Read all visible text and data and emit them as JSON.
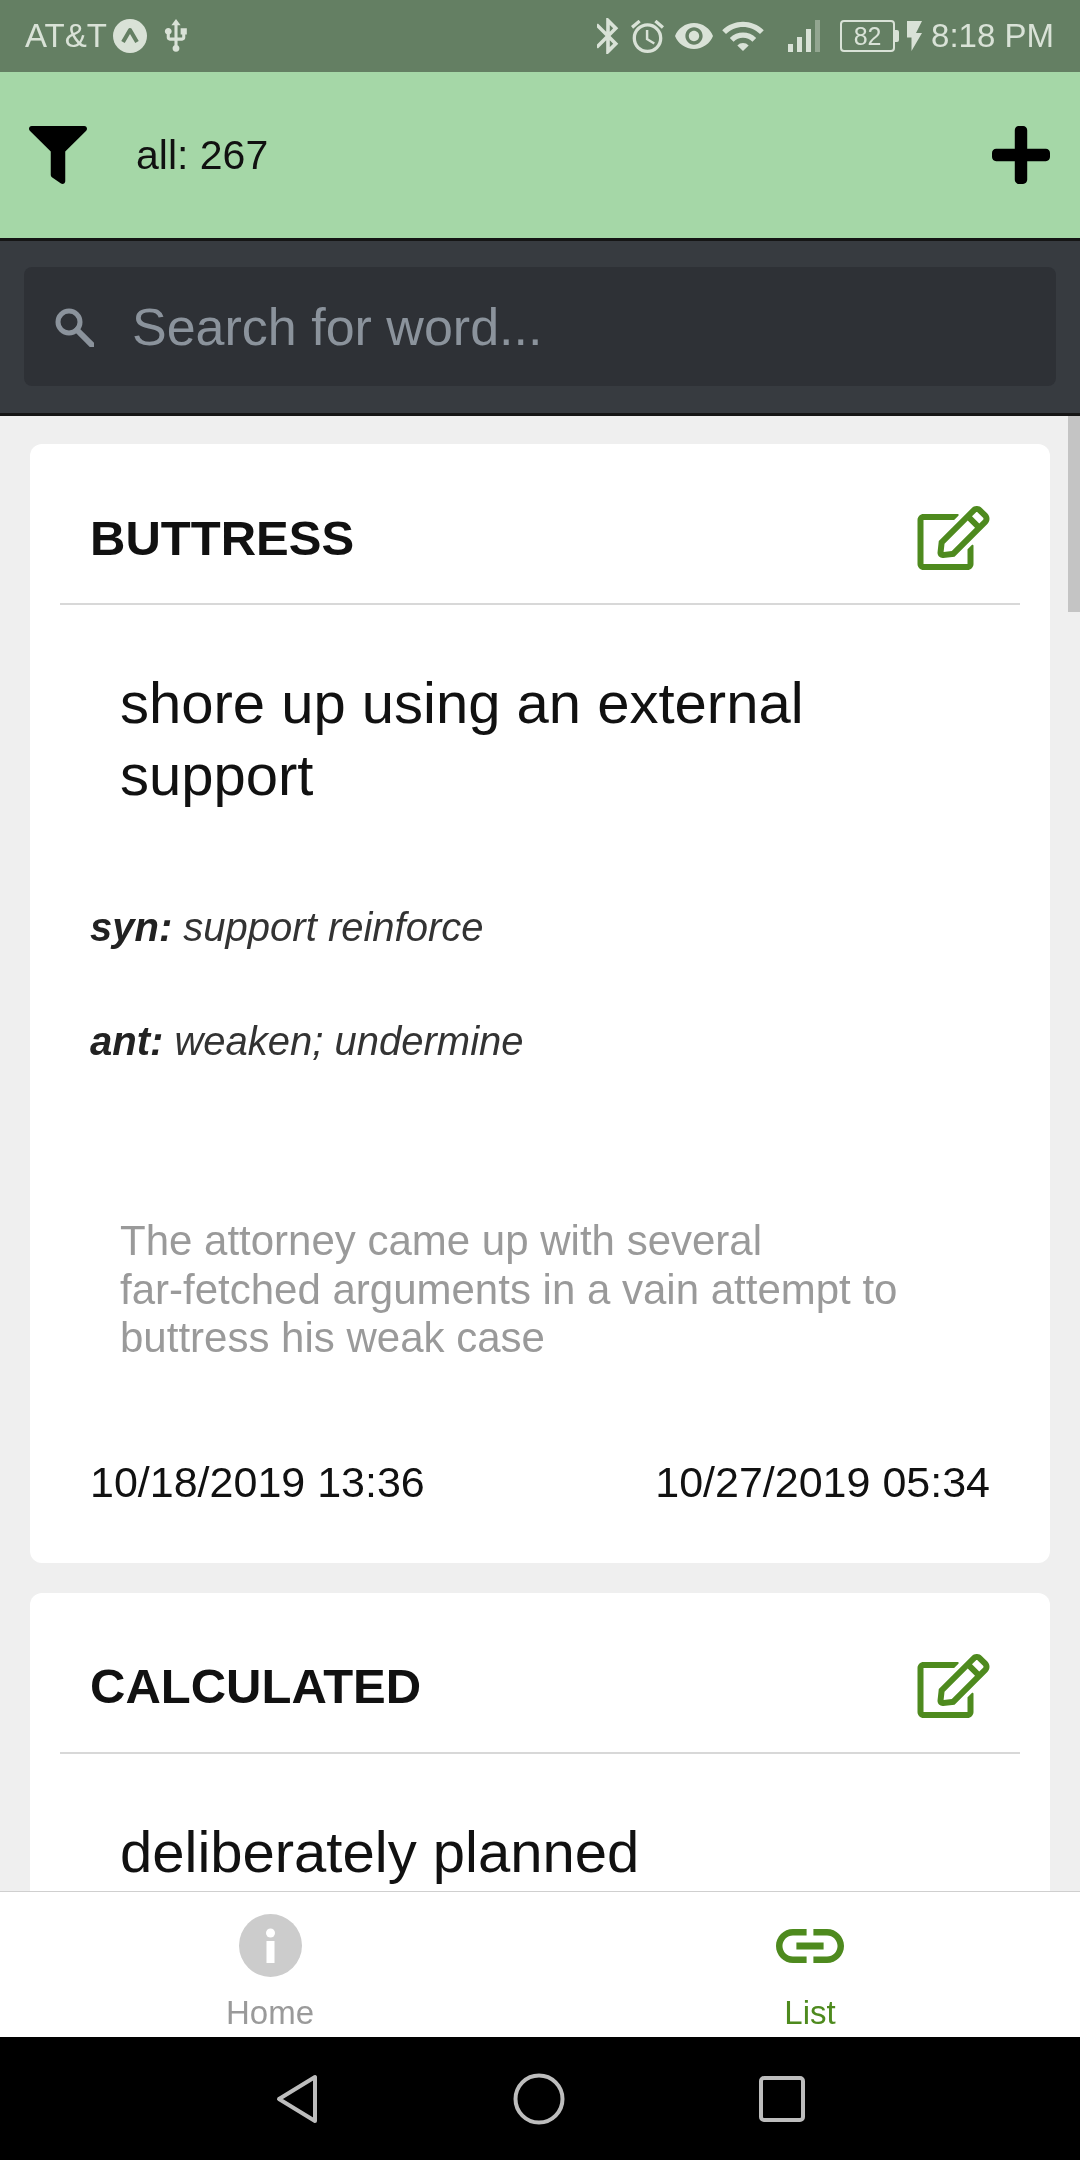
{
  "status_bar": {
    "carrier": "AT&T",
    "battery": "82",
    "time": "8:18 PM"
  },
  "header": {
    "count": "all: 267"
  },
  "search": {
    "placeholder": "Search for word..."
  },
  "words": [
    {
      "word": "BUTTRESS",
      "definition": "shore up using an external support",
      "synonyms": "**syn:** support reinforce",
      "antonyms": "**ant:** weaken; undermine",
      "example": "The attorney came up with several far-fetched arguments in a vain attempt to buttress his weak case",
      "created": "10/18/2019 13:36",
      "updated": "10/27/2019 05:34"
    },
    {
      "word": "CALCULATED",
      "definition": "deliberately planned"
    }
  ],
  "tab_bar": [
    {
      "label": "Home",
      "selected": false
    },
    {
      "label": "List",
      "selected": true
    }
  ]
}
